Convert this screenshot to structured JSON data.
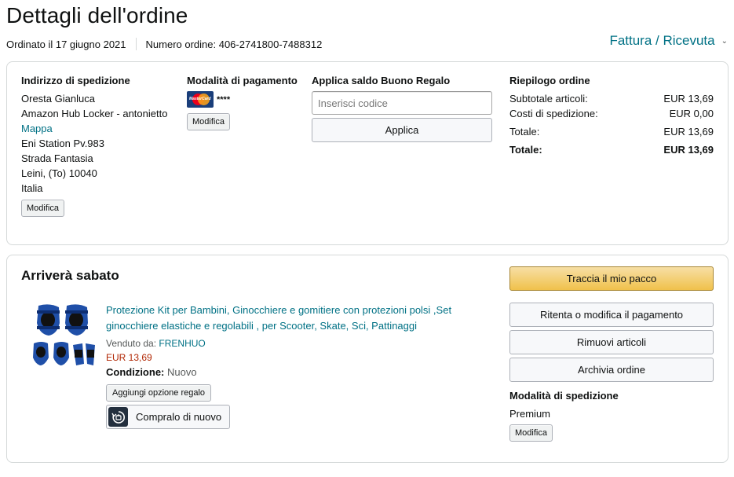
{
  "page": {
    "title": "Dettagli dell'ordine",
    "ordered_on": "Ordinato il 17 giugno 2021",
    "order_number": "Numero ordine: 406-2741800-7488312",
    "invoice_label": "Fattura / Ricevuta"
  },
  "shipping_address": {
    "title": "Indirizzo di spedizione",
    "name": "Oresta Gianluca",
    "locker": "Amazon Hub Locker - antonietto",
    "map_link": "Mappa",
    "line1": "Eni Station Pv.983",
    "line2": "Strada Fantasia",
    "city": "Leini, (To) 10040",
    "country": "Italia",
    "edit_label": "Modifica"
  },
  "payment": {
    "title": "Modalità di pagamento",
    "card_masked": "****",
    "card_logo": "MasterCard",
    "edit_label": "Modifica",
    "card_icon": "mastercard-icon"
  },
  "gift": {
    "title": "Applica saldo Buono Regalo",
    "placeholder": "Inserisci codice",
    "apply_label": "Applica"
  },
  "summary": {
    "title": "Riepilogo ordine",
    "rows": [
      {
        "label": "Subtotale articoli:",
        "value": "EUR 13,69"
      },
      {
        "label": "Costi di spedizione:",
        "value": "EUR 0,00"
      },
      {
        "label": "Totale:",
        "value": "EUR 13,69"
      }
    ],
    "grand_total_label": "Totale:",
    "grand_total_value": "EUR 13,69"
  },
  "shipment": {
    "arrival": "Arriverà sabato",
    "product": {
      "title": "Protezione Kit per Bambini, Ginocchiere e gomitiere con protezioni polsi ,Set ginocchiere elastiche e regolabili , per Scooter, Skate, Sci, Pattinaggi",
      "sold_by_label": "Venduto da:",
      "seller": "FRENHUO",
      "price": "EUR 13,69",
      "condition_label": "Condizione:",
      "condition_value": "Nuovo",
      "gift_option_label": "Aggiungi opzione regalo",
      "buy_again_label": "Compralo di nuovo"
    },
    "actions": {
      "track": "Traccia il mio pacco",
      "retry_payment": "Ritenta o modifica il pagamento",
      "remove_items": "Rimuovi articoli",
      "archive": "Archivia ordine"
    },
    "shipping_method": {
      "title": "Modalità di spedizione",
      "value": "Premium",
      "edit_label": "Modifica"
    }
  },
  "colors": {
    "link": "#007185",
    "price": "#b12704",
    "primary_button": "#f0c14b",
    "border": "#d5d9d9"
  }
}
